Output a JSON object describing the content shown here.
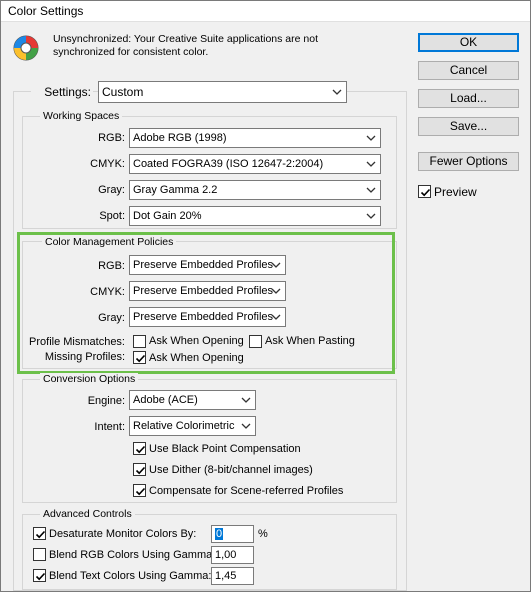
{
  "window": {
    "title": "Color Settings"
  },
  "message": "Unsynchronized: Your Creative Suite applications are not synchronized for consistent color.",
  "buttons": {
    "ok": "OK",
    "cancel": "Cancel",
    "load": "Load...",
    "save": "Save...",
    "fewer_options": "Fewer Options"
  },
  "preview_label": "Preview",
  "preview_checked": true,
  "settings": {
    "label": "Settings:",
    "value": "Custom"
  },
  "working_spaces": {
    "title": "Working Spaces",
    "rgb_label": "RGB:",
    "rgb_value": "Adobe RGB (1998)",
    "cmyk_label": "CMYK:",
    "cmyk_value": "Coated FOGRA39 (ISO 12647-2:2004)",
    "gray_label": "Gray:",
    "gray_value": "Gray Gamma 2.2",
    "spot_label": "Spot:",
    "spot_value": "Dot Gain 20%"
  },
  "policies": {
    "title": "Color Management Policies",
    "rgb_label": "RGB:",
    "rgb_value": "Preserve Embedded Profiles",
    "cmyk_label": "CMYK:",
    "cmyk_value": "Preserve Embedded Profiles",
    "gray_label": "Gray:",
    "gray_value": "Preserve Embedded Profiles",
    "mismatch_label": "Profile Mismatches:",
    "ask_opening": "Ask When Opening",
    "ask_opening_checked": false,
    "ask_pasting": "Ask When Pasting",
    "ask_pasting_checked": false,
    "missing_label": "Missing Profiles:",
    "missing_ask_opening": "Ask When Opening",
    "missing_ask_opening_checked": true
  },
  "conversion": {
    "title": "Conversion Options",
    "engine_label": "Engine:",
    "engine_value": "Adobe (ACE)",
    "intent_label": "Intent:",
    "intent_value": "Relative Colorimetric",
    "bpc": "Use Black Point Compensation",
    "bpc_checked": true,
    "dither": "Use Dither (8-bit/channel images)",
    "dither_checked": true,
    "scene": "Compensate for Scene-referred Profiles",
    "scene_checked": true
  },
  "advanced": {
    "title": "Advanced Controls",
    "desaturate": "Desaturate Monitor Colors By:",
    "desaturate_checked": true,
    "desaturate_value": "0",
    "desaturate_unit": "%",
    "blend_rgb": "Blend RGB Colors Using Gamma:",
    "blend_rgb_checked": false,
    "blend_rgb_value": "1,00",
    "blend_text": "Blend Text Colors Using Gamma:",
    "blend_text_checked": true,
    "blend_text_value": "1,45"
  },
  "colors": {
    "highlight": "#6cc04a",
    "accent": "#0078d7"
  }
}
